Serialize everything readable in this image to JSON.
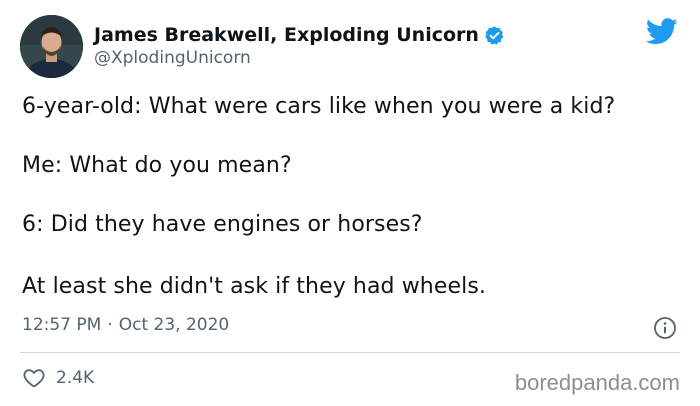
{
  "author": {
    "display_name": "James Breakwell, Exploding Unicorn",
    "handle": "@XplodingUnicorn",
    "verified": true
  },
  "tweet": {
    "lines": [
      "6-year-old: What were cars like when you were a kid?",
      "Me: What do you mean?",
      "6: Did they have engines or horses?",
      "At least she didn't ask if they had wheels."
    ],
    "time": "12:57 PM",
    "separator": "·",
    "date": "Oct 23, 2020",
    "likes": "2.4K"
  },
  "watermark": "boredpanda.com",
  "colors": {
    "twitter_blue": "#1d9bf0",
    "text_primary": "#0f1419",
    "text_secondary": "#536471",
    "divider": "#cfd9de"
  },
  "icons": {
    "brand": "twitter-bird-icon",
    "verified": "verified-badge-icon",
    "info": "info-icon",
    "like": "heart-icon"
  }
}
